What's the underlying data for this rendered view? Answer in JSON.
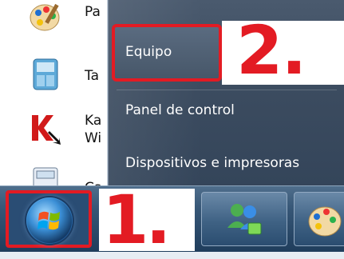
{
  "programs": [
    {
      "label": "Pa",
      "icon": "paint-icon"
    },
    {
      "label": "Ta",
      "icon": "gadgets-icon"
    },
    {
      "label": "Ka",
      "label2": "Wi",
      "icon": "kaspersky-icon"
    },
    {
      "label": "Ca",
      "icon": "calculator-icon"
    }
  ],
  "menu": {
    "equipo": "Equipo",
    "panel": "Panel de control",
    "dispositivos": "Dispositivos e impresoras"
  },
  "callouts": {
    "one": "1.",
    "two": "2."
  },
  "colors": {
    "highlight": "#e31b23"
  }
}
